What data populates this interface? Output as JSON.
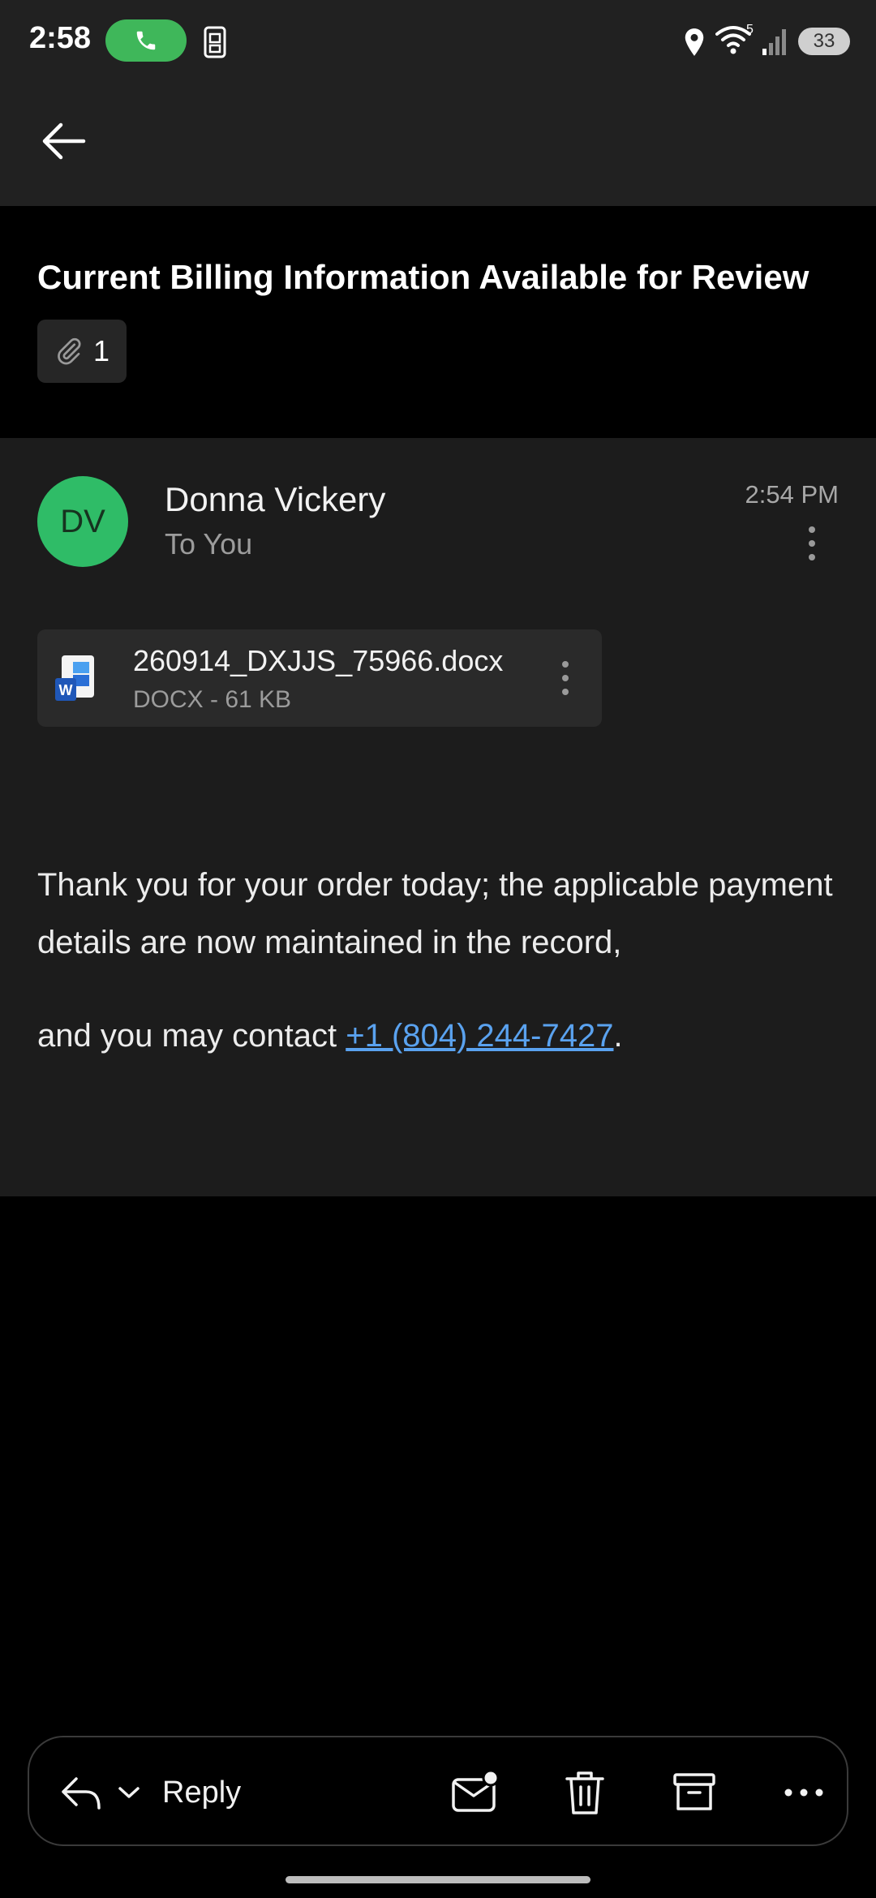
{
  "status_bar": {
    "time": "2:58",
    "wifi_generation": "5",
    "battery_level": "33"
  },
  "subject": {
    "title": "Current Billing Information Available for Review",
    "attachment_count": "1"
  },
  "message": {
    "avatar_initials": "DV",
    "avatar_color": "#2fbc67",
    "sender_name": "Donna Vickery",
    "recipient_line": "To You",
    "time": "2:54 PM",
    "attachment": {
      "file_name": "260914_DXJJS_75966.docx",
      "file_meta": "DOCX - 61 KB",
      "icon": "word-doc-icon"
    },
    "body_line1": "Thank you for your order today; the applicable payment details are now maintained in the record,",
    "body_line2_prefix": "and you may contact ",
    "body_phone": "+1 (804) 244-7427",
    "body_line2_suffix": ".",
    "link_color": "#5aa2ef"
  },
  "action_bar": {
    "reply_label": "Reply",
    "icons": [
      "reply-icon",
      "chevron-down-icon",
      "mark-unread-icon",
      "trash-icon",
      "archive-icon",
      "more-horizontal-icon"
    ]
  }
}
